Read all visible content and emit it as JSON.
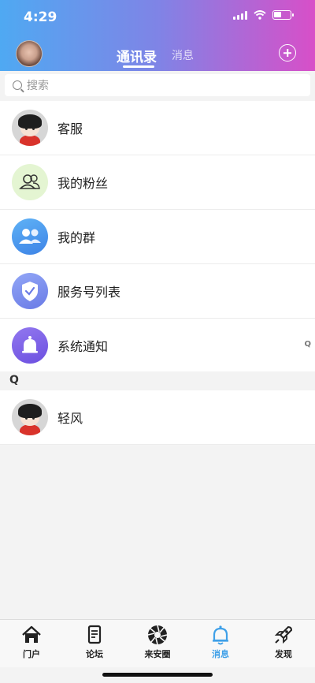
{
  "status": {
    "time": "4:29"
  },
  "header": {
    "tab_active": "通讯录",
    "tab_inactive": "消息"
  },
  "search": {
    "placeholder": "搜索"
  },
  "list": [
    {
      "label": "客服",
      "icon": "cartoon-avatar-icon"
    },
    {
      "label": "我的粉丝",
      "icon": "fans-icon"
    },
    {
      "label": "我的群",
      "icon": "groups-icon"
    },
    {
      "label": "服务号列表",
      "icon": "shield-check-icon"
    },
    {
      "label": "系统通知",
      "icon": "bell-icon"
    }
  ],
  "index_letter": "Q",
  "section": {
    "letter": "Q",
    "contacts": [
      {
        "label": "轻风"
      }
    ]
  },
  "tabbar": [
    {
      "label": "门户",
      "icon": "home-icon"
    },
    {
      "label": "论坛",
      "icon": "forum-icon"
    },
    {
      "label": "来安圈",
      "icon": "aperture-icon"
    },
    {
      "label": "消息",
      "icon": "bell-icon",
      "active": true
    },
    {
      "label": "发现",
      "icon": "rocket-icon"
    }
  ],
  "colors": {
    "accent": "#3fa0e8",
    "gradient_start": "#4fa9f2",
    "gradient_end": "#d84fc8"
  }
}
